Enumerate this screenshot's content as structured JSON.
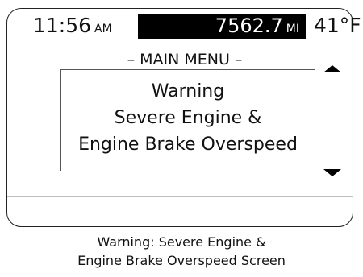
{
  "status_bar": {
    "time": "11:56",
    "time_suffix": "AM",
    "odometer_value": "7562.7",
    "odometer_unit": "MI",
    "temperature": "41°F"
  },
  "menu": {
    "title": "– MAIN MENU –"
  },
  "warning": {
    "lines": [
      "Warning",
      "Severe Engine &",
      "Engine Brake Overspeed"
    ]
  },
  "scroll": {
    "up_icon": "triangle-up",
    "down_icon": "triangle-down"
  },
  "caption": {
    "lines": [
      "Warning: Severe Engine &",
      "Engine Brake Overspeed Screen"
    ]
  },
  "colors": {
    "screen_bg": "#ffffff",
    "odometer_bg": "#000000",
    "odometer_text": "#ffffff",
    "text": "#111111"
  }
}
